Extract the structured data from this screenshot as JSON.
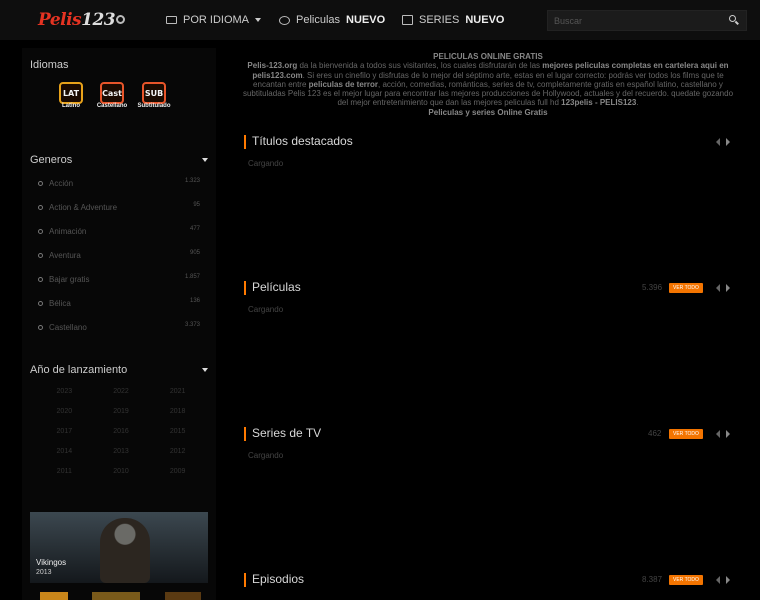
{
  "header": {
    "logo_part1": "Pelis",
    "logo_part2": "123",
    "nav_idioma": "POR IDIOMA",
    "nav_peliculas": "Peliculas",
    "nav_peliculas_badge": "NUEVO",
    "nav_series": "SERIES",
    "nav_series_badge": "NUEVO",
    "search_placeholder": "Buscar"
  },
  "sidebar": {
    "idiomas_title": "Idiomas",
    "languages": [
      {
        "abbr": "LAT",
        "label": "Latino"
      },
      {
        "abbr": "Cast",
        "label": "Castellano"
      },
      {
        "abbr": "SUB",
        "label": "Subtitulado"
      }
    ],
    "generos_title": "Generos",
    "genres": [
      {
        "name": "Acción",
        "count": "1.323"
      },
      {
        "name": "Action & Adventure",
        "count": "95"
      },
      {
        "name": "Animación",
        "count": "477"
      },
      {
        "name": "Aventura",
        "count": "905"
      },
      {
        "name": "Bajar gratis",
        "count": "1.857"
      },
      {
        "name": "Bélica",
        "count": "136"
      },
      {
        "name": "Castellano",
        "count": "3.373"
      }
    ],
    "anio_title": "Año de lanzamiento",
    "years": [
      "2023",
      "2022",
      "2021",
      "2020",
      "2019",
      "2018",
      "2017",
      "2016",
      "2015",
      "2014",
      "2013",
      "2012",
      "2011",
      "2010",
      "2009"
    ],
    "feature": {
      "title": "Vikingos",
      "year": "2013"
    }
  },
  "intro": {
    "heading": "PELICULAS ONLINE GRATIS",
    "p1_bold": "Pelis-123.org",
    "p1_text": " da la bienvenida a todos sus visitantes, los cuales disfrutarán de las ",
    "p1_bold2": "mejores peliculas completas en cartelera aqui en pelis123.com",
    "p1_text2": ". Si eres un cinefilo y disfrutas de lo mejor del séptimo arte, estas en el lugar correcto: podrás ver todos los films que te encantan entre ",
    "p1_bold3": "peliculas de terror",
    "p1_text3": ", acción, comedias, románticas, series de tv, completamente gratis en español latino, castellano y subtituladas Pelis 123 es el mejor lugar para encontrar las mejores producciones de Hollywood, actuales y del recuerdo. quedate gozando del mejor entretenimiento que dan las mejores peliculas full hd ",
    "p1_bold4": "123pelis - PELIS123",
    "p1_end": ".",
    "footer_bold": "Peliculas y series Online Gratis"
  },
  "sections": [
    {
      "title": "Títulos destacados",
      "count": "",
      "see_all": "",
      "loading": "Cargando"
    },
    {
      "title": "Películas",
      "count": "5.396",
      "see_all": "VER TODO",
      "loading": "Cargando"
    },
    {
      "title": "Series de TV",
      "count": "462",
      "see_all": "VER TODO",
      "loading": "Cargando"
    },
    {
      "title": "Episodios",
      "count": "8.387",
      "see_all": "VER TODO",
      "loading": ""
    }
  ],
  "colors": {
    "accent": "#f37400",
    "logo_red": "#e53322"
  }
}
